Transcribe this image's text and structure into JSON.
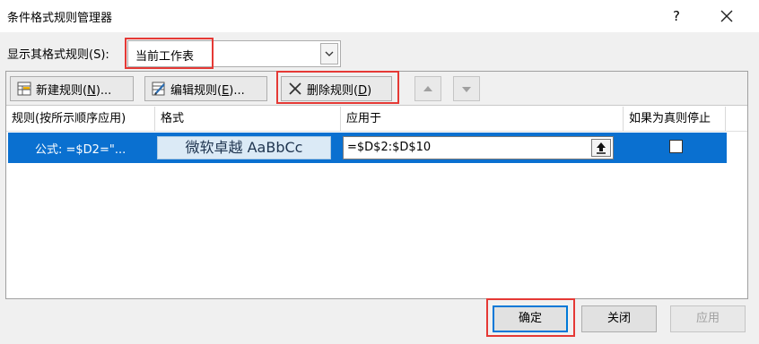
{
  "dialog": {
    "title": "条件格式规则管理器",
    "help": "?"
  },
  "show_rules": {
    "label": "显示其格式规则(S):",
    "selected": "当前工作表"
  },
  "toolbar": {
    "new_rule": {
      "text": "新建规则(",
      "key": "N",
      "tail": ")..."
    },
    "edit_rule": {
      "text": "编辑规则(",
      "key": "E",
      "tail": ")..."
    },
    "delete_rule": {
      "text": "删除规则(",
      "key": "D",
      "tail": ")"
    }
  },
  "table": {
    "headers": [
      "规则(按所示顺序应用)",
      "格式",
      "应用于",
      "如果为真则停止"
    ],
    "rows": [
      {
        "rule": "公式: =$D2=\"...",
        "format_preview": "微软卓越  AaBbCc",
        "applies_to": "=$D$2:$D$10",
        "stop_if_true": false
      }
    ]
  },
  "buttons": {
    "ok": "确定",
    "close": "关闭",
    "apply": "应用"
  },
  "colors": {
    "selection": "#0a70d0",
    "highlight_box": "#e53935",
    "focus": "#0078d7"
  }
}
